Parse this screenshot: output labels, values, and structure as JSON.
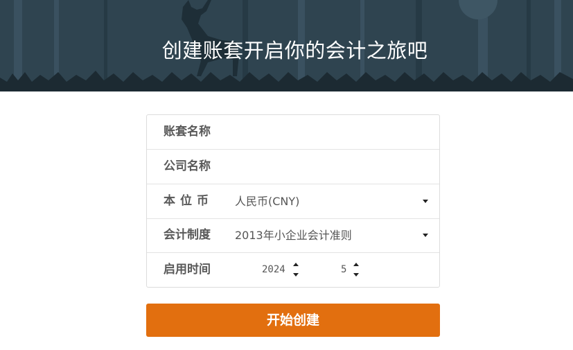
{
  "banner": {
    "title": "创建账套开启你的会计之旅吧",
    "bg_color": "#2f4450"
  },
  "form": {
    "account_name_label": "账套名称",
    "company_name_label": "公司名称",
    "currency_label": "本位币",
    "currency_value": "人民币(CNY)",
    "accounting_system_label": "会计制度",
    "accounting_system_value": "2013年小企业会计准则",
    "start_time_label": "启用时间",
    "start_year": "2024",
    "start_month": "5"
  },
  "submit": {
    "label": "开始创建",
    "color": "#e26f0f"
  }
}
